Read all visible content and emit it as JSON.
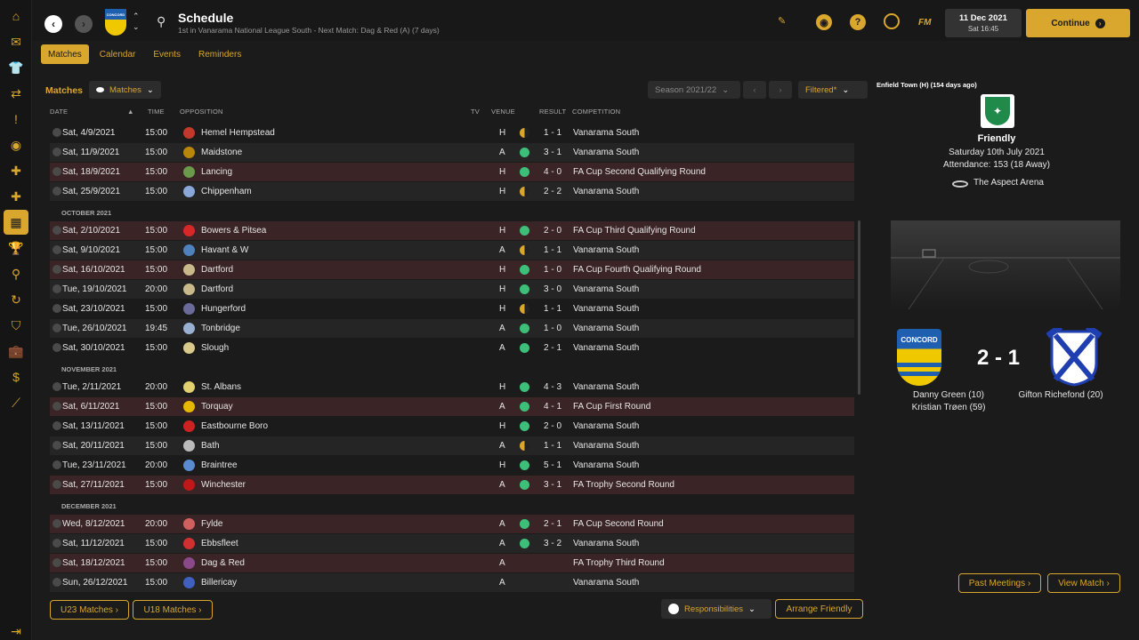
{
  "sidebar": {
    "icons": [
      "home-icon",
      "inbox-icon",
      "squad-icon",
      "transfers-icon",
      "tactics-icon",
      "training-icon",
      "medical-icon",
      "scouting-icon",
      "schedule-icon",
      "competitions-icon",
      "search-icon",
      "dynamics-icon",
      "club-icon",
      "finances-icon",
      "money-icon",
      "trends-icon",
      "exit-icon"
    ]
  },
  "header": {
    "title": "Schedule",
    "subtitle": "1st in Vanarama National League South - Next Match: Dag & Red (A) (7 days)",
    "date": "11 Dec 2021",
    "time": "Sat 16:45",
    "continue_label": "Continue",
    "fm_label": "FM",
    "club_badge_text": "CONCORD"
  },
  "tabs": [
    {
      "label": "Matches",
      "active": true
    },
    {
      "label": "Calendar",
      "active": false
    },
    {
      "label": "Events",
      "active": false
    },
    {
      "label": "Reminders",
      "active": false
    }
  ],
  "filters": {
    "section_label": "Matches",
    "view_label": "Matches",
    "season_label": "Season 2021/22",
    "filter_label": "Filtered*"
  },
  "columns": {
    "date": "DATE",
    "time": "TIME",
    "opposition": "OPPOSITION",
    "tv": "TV",
    "venue": "VENUE",
    "result": "RESULT",
    "competition": "COMPETITION"
  },
  "fixtures": [
    {
      "date": "Sat, 4/9/2021",
      "time": "15:00",
      "opp": "Hemel Hempstead",
      "venue": "H",
      "outcome": "D",
      "result": "1 - 1",
      "comp": "Vanarama South",
      "crest": "#c0392b"
    },
    {
      "date": "Sat, 11/9/2021",
      "time": "15:00",
      "opp": "Maidstone",
      "venue": "A",
      "outcome": "W",
      "result": "3 - 1",
      "comp": "Vanarama South",
      "crest": "#b8860b"
    },
    {
      "date": "Sat, 18/9/2021",
      "time": "15:00",
      "opp": "Lancing",
      "venue": "H",
      "outcome": "W",
      "result": "4 - 0",
      "comp": "FA Cup Second Qualifying Round",
      "crest": "#6a9a4a"
    },
    {
      "date": "Sat, 25/9/2021",
      "time": "15:00",
      "opp": "Chippenham",
      "venue": "H",
      "outcome": "D",
      "result": "2 - 2",
      "comp": "Vanarama South",
      "crest": "#8aa7d9"
    },
    {
      "month": "OCTOBER 2021"
    },
    {
      "date": "Sat, 2/10/2021",
      "time": "15:00",
      "opp": "Bowers & Pitsea",
      "venue": "H",
      "outcome": "W",
      "result": "2 - 0",
      "comp": "FA Cup Third Qualifying Round",
      "crest": "#d62828"
    },
    {
      "date": "Sat, 9/10/2021",
      "time": "15:00",
      "opp": "Havant & W",
      "venue": "A",
      "outcome": "D",
      "result": "1 - 1",
      "comp": "Vanarama South",
      "crest": "#4f81bd"
    },
    {
      "date": "Sat, 16/10/2021",
      "time": "15:00",
      "opp": "Dartford",
      "venue": "H",
      "outcome": "W",
      "result": "1 - 0",
      "comp": "FA Cup Fourth Qualifying Round",
      "crest": "#c9b98a"
    },
    {
      "date": "Tue, 19/10/2021",
      "time": "20:00",
      "opp": "Dartford",
      "venue": "H",
      "outcome": "W",
      "result": "3 - 0",
      "comp": "Vanarama South",
      "crest": "#c9b98a"
    },
    {
      "date": "Sat, 23/10/2021",
      "time": "15:00",
      "opp": "Hungerford",
      "venue": "H",
      "outcome": "D",
      "result": "1 - 1",
      "comp": "Vanarama South",
      "crest": "#6b6b9a"
    },
    {
      "date": "Tue, 26/10/2021",
      "time": "19:45",
      "opp": "Tonbridge",
      "venue": "A",
      "outcome": "W",
      "result": "1 - 0",
      "comp": "Vanarama South",
      "crest": "#9ab0d0"
    },
    {
      "date": "Sat, 30/10/2021",
      "time": "15:00",
      "opp": "Slough",
      "venue": "A",
      "outcome": "W",
      "result": "2 - 1",
      "comp": "Vanarama South",
      "crest": "#d9c98a"
    },
    {
      "month": "NOVEMBER 2021"
    },
    {
      "date": "Tue, 2/11/2021",
      "time": "20:00",
      "opp": "St. Albans",
      "venue": "H",
      "outcome": "W",
      "result": "4 - 3",
      "comp": "Vanarama South",
      "crest": "#e0d070"
    },
    {
      "date": "Sat, 6/11/2021",
      "time": "15:00",
      "opp": "Torquay",
      "venue": "A",
      "outcome": "W",
      "result": "4 - 1",
      "comp": "FA Cup First Round",
      "crest": "#e6b800"
    },
    {
      "date": "Sat, 13/11/2021",
      "time": "15:00",
      "opp": "Eastbourne Boro",
      "venue": "H",
      "outcome": "W",
      "result": "2 - 0",
      "comp": "Vanarama South",
      "crest": "#cc2222"
    },
    {
      "date": "Sat, 20/11/2021",
      "time": "15:00",
      "opp": "Bath",
      "venue": "A",
      "outcome": "D",
      "result": "1 - 1",
      "comp": "Vanarama South",
      "crest": "#bbbbbb"
    },
    {
      "date": "Tue, 23/11/2021",
      "time": "20:00",
      "opp": "Braintree",
      "venue": "H",
      "outcome": "W",
      "result": "5 - 1",
      "comp": "Vanarama South",
      "crest": "#5a8ad0"
    },
    {
      "date": "Sat, 27/11/2021",
      "time": "15:00",
      "opp": "Winchester",
      "venue": "A",
      "outcome": "W",
      "result": "3 - 1",
      "comp": "FA Trophy Second Round",
      "crest": "#c01818"
    },
    {
      "month": "DECEMBER 2021"
    },
    {
      "date": "Wed, 8/12/2021",
      "time": "20:00",
      "opp": "Fylde",
      "venue": "A",
      "outcome": "W",
      "result": "2 - 1",
      "comp": "FA Cup Second Round",
      "crest": "#d06060"
    },
    {
      "date": "Sat, 11/12/2021",
      "time": "15:00",
      "opp": "Ebbsfleet",
      "venue": "A",
      "outcome": "W",
      "result": "3 - 2",
      "comp": "Vanarama South",
      "crest": "#d03030"
    },
    {
      "date": "Sat, 18/12/2021",
      "time": "15:00",
      "opp": "Dag & Red",
      "venue": "A",
      "outcome": "",
      "result": "",
      "comp": "FA Trophy Third Round",
      "crest": "#8a4a8a"
    },
    {
      "date": "Sun, 26/12/2021",
      "time": "15:00",
      "opp": "Billericay",
      "venue": "A",
      "outcome": "",
      "result": "",
      "comp": "Vanarama South",
      "crest": "#4060c0"
    }
  ],
  "match_panel": {
    "header": "Enfield Town (H) (154 days ago)",
    "type": "Friendly",
    "date": "Saturday 10th July 2021",
    "attendance": "Attendance: 153 (18 Away)",
    "stadium": "The Aspect Arena",
    "score": "2 - 1",
    "home_badge_text": "CONCORD",
    "home_scorers": [
      "Danny Green (10)",
      "Kristian Trøen (59)"
    ],
    "away_scorers": [
      "Gifton Richefond (20)"
    ],
    "past_meetings_label": "Past Meetings",
    "view_match_label": "View Match"
  },
  "footer": {
    "u23_label": "U23 Matches",
    "u18_label": "U18 Matches",
    "responsibilities_label": "Responsibilities",
    "arrange_friendly_label": "Arrange Friendly"
  },
  "colors": {
    "accent": "#d9a62e",
    "win": "#3dbf7a",
    "draw": "#d9a62e",
    "cup_row": "#3a2426"
  }
}
